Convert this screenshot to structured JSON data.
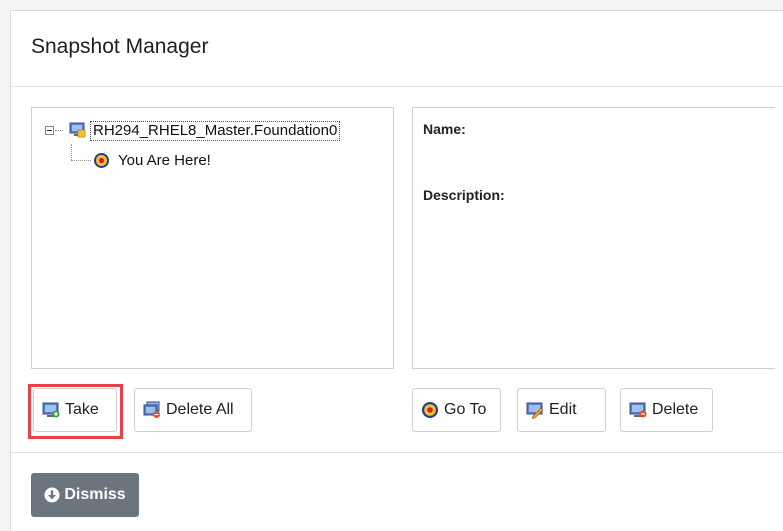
{
  "dialog": {
    "title": "Snapshot Manager"
  },
  "tree": {
    "root_label": "RH294_RHEL8_Master.Foundation0",
    "current_label": "You Are Here!"
  },
  "details": {
    "name_label": "Name:",
    "description_label": "Description:"
  },
  "buttons": {
    "take": "Take",
    "delete_all": "Delete All",
    "go_to": "Go To",
    "edit": "Edit",
    "delete": "Delete",
    "dismiss": "Dismiss"
  },
  "colors": {
    "highlight": "#e8414a",
    "dismiss_bg": "#6c757d"
  }
}
